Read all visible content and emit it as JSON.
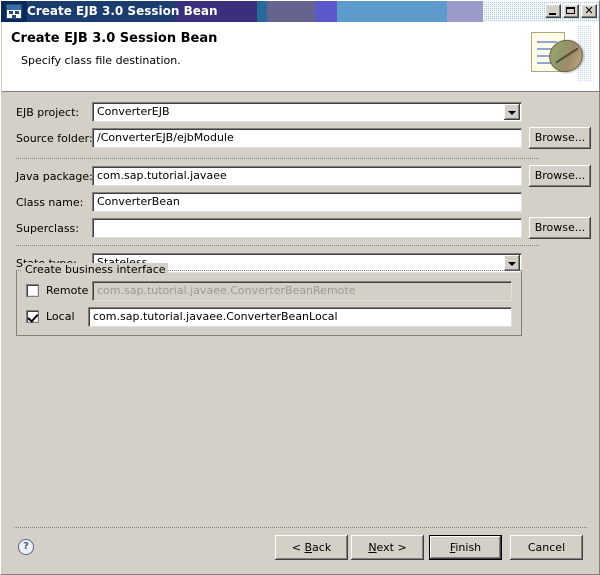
{
  "window": {
    "title": "Create EJB 3.0 Session Bean",
    "icon": "ejb-wizard-icon",
    "minimize_label": "Minimize",
    "maximize_label": "Maximize",
    "close_label": "✕"
  },
  "header": {
    "title": "Create EJB 3.0 Session Bean",
    "subtitle": "Specify class file destination.",
    "icon": "java-bean-document-icon"
  },
  "form": {
    "ejb_project": {
      "label": "EJB project:",
      "value": "ConverterEJB",
      "control": "combobox"
    },
    "source_folder": {
      "label": "Source folder:",
      "value": "/ConverterEJB/ejbModule",
      "browse_label": "Browse..."
    },
    "java_package": {
      "label": "Java package:",
      "value": "com.sap.tutorial.javaee",
      "browse_label": "Browse..."
    },
    "class_name": {
      "label": "Class name:",
      "value": "ConverterBean"
    },
    "superclass": {
      "label": "Superclass:",
      "value": "",
      "browse_label": "Browse..."
    },
    "state_type": {
      "label": "State type:",
      "value": "Stateless",
      "control": "combobox"
    }
  },
  "business_interface": {
    "legend": "Create business interface",
    "remote": {
      "label": "Remote",
      "checked": false,
      "value": "com.sap.tutorial.javaee.ConverterBeanRemote",
      "enabled": false
    },
    "local": {
      "label": "Local",
      "checked": true,
      "value": "com.sap.tutorial.javaee.ConverterBeanLocal",
      "enabled": true
    }
  },
  "footer": {
    "help_label": "?",
    "back": {
      "prefix": "< ",
      "mnemonic": "B",
      "suffix": "ack"
    },
    "next": {
      "prefix": "",
      "mnemonic": "N",
      "suffix": "ext >"
    },
    "finish": {
      "prefix": "",
      "mnemonic": "F",
      "suffix": "inish"
    },
    "cancel": {
      "label": "Cancel"
    }
  },
  "colors": {
    "dialog_face": "#d4d0c8",
    "titlebar_start": "#0a2a5a",
    "header_background": "#ffffff",
    "field_background": "#ffffff",
    "disabled_text": "#9a9a9a"
  }
}
